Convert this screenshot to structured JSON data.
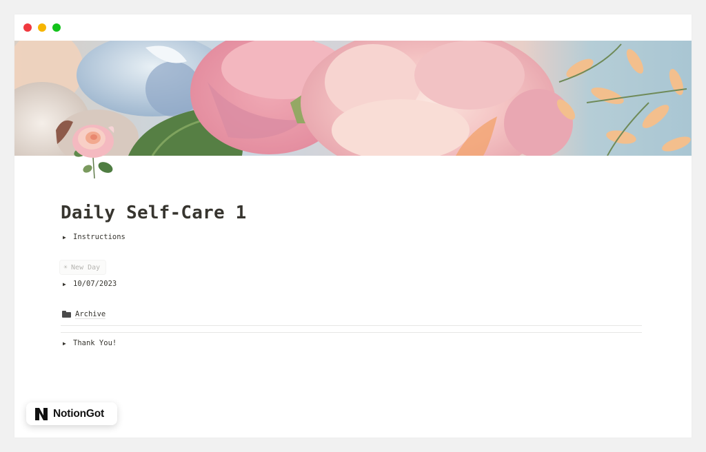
{
  "window": {
    "controls": [
      "close",
      "minimize",
      "maximize"
    ],
    "control_colors": {
      "close": "#f0393f",
      "minimize": "#f6b500",
      "maximize": "#13c21b"
    }
  },
  "cover": {
    "description": "Painted floral cover image with pink peonies, blue flowers and peach blossoms",
    "colors": {
      "sky": "#a9c6d3",
      "pink": "#f2b9bd",
      "peach": "#f4c69a",
      "leaf": "#5f8a4c",
      "blue": "#b8cfe0"
    }
  },
  "page": {
    "icon": "rose-icon",
    "title": "Daily Self-Care 1",
    "blocks": [
      {
        "type": "toggle",
        "label": "Instructions"
      },
      {
        "type": "button",
        "icon": "sun-icon",
        "label": "New Day"
      },
      {
        "type": "toggle",
        "label": "10/07/2023"
      },
      {
        "type": "link",
        "icon": "folder-icon",
        "label": "Archive"
      },
      {
        "type": "divider"
      },
      {
        "type": "divider"
      },
      {
        "type": "toggle",
        "label": "Thank You!"
      }
    ]
  },
  "watermark": {
    "logo": "N",
    "brand": "NotionGot"
  }
}
